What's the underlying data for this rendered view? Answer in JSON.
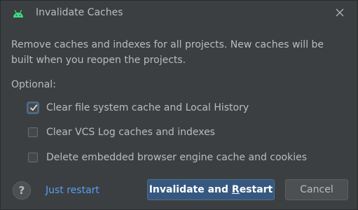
{
  "window": {
    "title": "Invalidate Caches",
    "app_icon": "android-icon",
    "close_icon": "close-icon"
  },
  "description": "Remove caches and indexes for all projects. New caches will be built when you reopen the projects.",
  "optional_label": "Optional:",
  "options": [
    {
      "label": "Clear file system cache and Local History",
      "checked": true
    },
    {
      "label": "Clear VCS Log caches and indexes",
      "checked": false
    },
    {
      "label": "Delete embedded browser engine cache and cookies",
      "checked": false
    }
  ],
  "footer": {
    "help_label": "?",
    "link_label": "Just restart",
    "primary_label_pre": "Invalidate and ",
    "primary_label_mnemonic": "R",
    "primary_label_post": "estart",
    "cancel_label": "Cancel"
  },
  "colors": {
    "background": "#3c3f41",
    "text": "#bbbbbb",
    "link": "#589df6",
    "primary_button": "#365880",
    "android_green": "#3ddc84"
  }
}
